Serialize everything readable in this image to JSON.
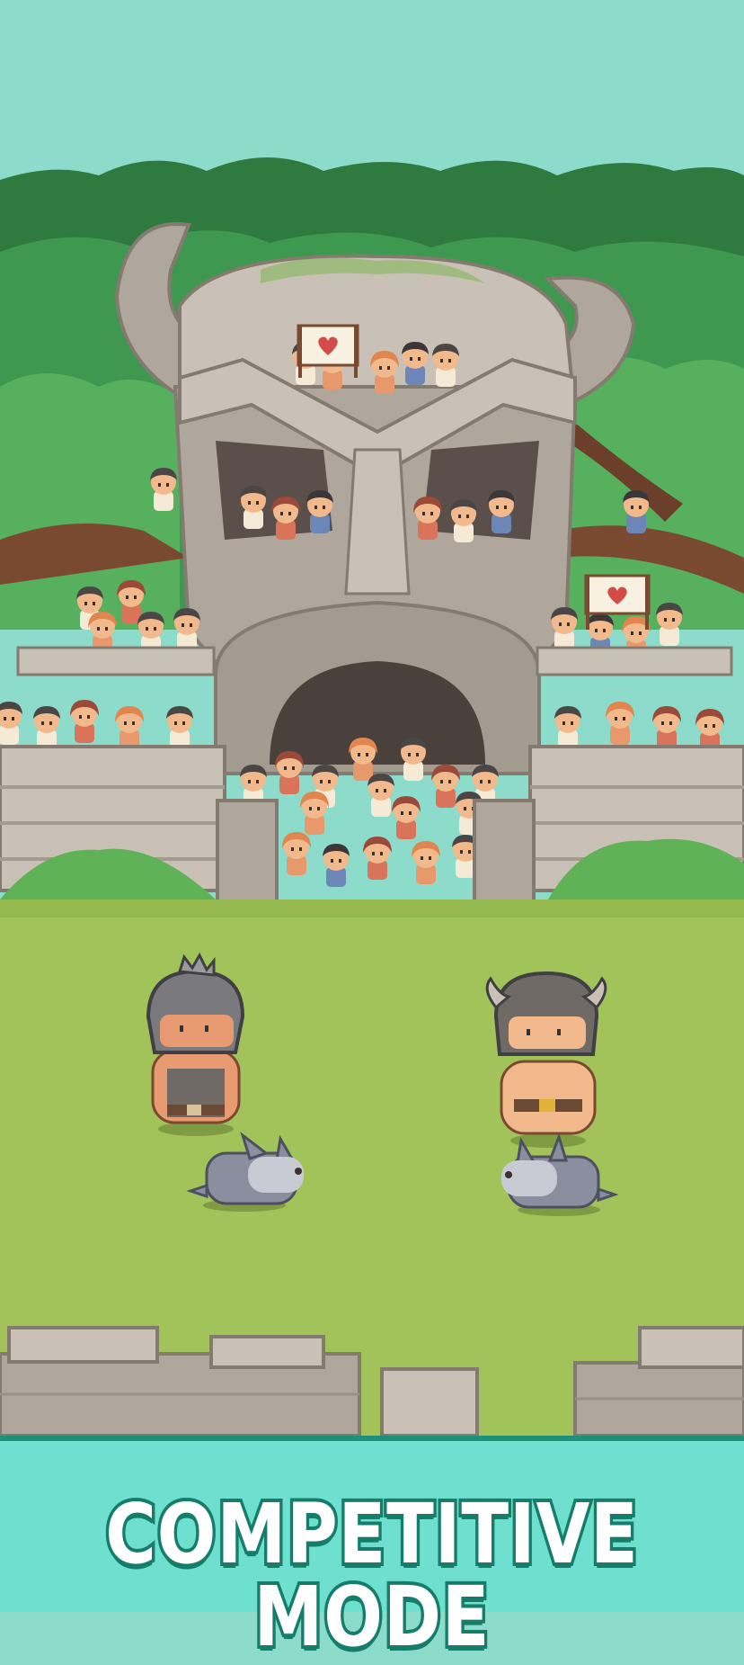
{
  "screen": {
    "banner": {
      "title": "COMPETITIVE MODE"
    },
    "palette": {
      "sky": "#8ddccb",
      "forest_dark": "#2f7a3e",
      "forest_mid": "#3f9850",
      "forest_light": "#56b05d",
      "stone_light": "#c9c1b6",
      "stone_mid": "#b0a79c",
      "stone_dark": "#857a70",
      "grass": "#a2c35a",
      "banner_bg": "#6fe0cf",
      "banner_outline": "#157d69",
      "wolf": "#8a8e9e",
      "helmet": "#7a7a7e"
    },
    "scene": {
      "left_fighter": {
        "helmet": "knight-helmet",
        "pet": "wolf"
      },
      "right_fighter": {
        "helmet": "viking-helmet",
        "pet": "wolf"
      },
      "crowd_signs": [
        "heart-sign",
        "heart-sign"
      ]
    }
  }
}
